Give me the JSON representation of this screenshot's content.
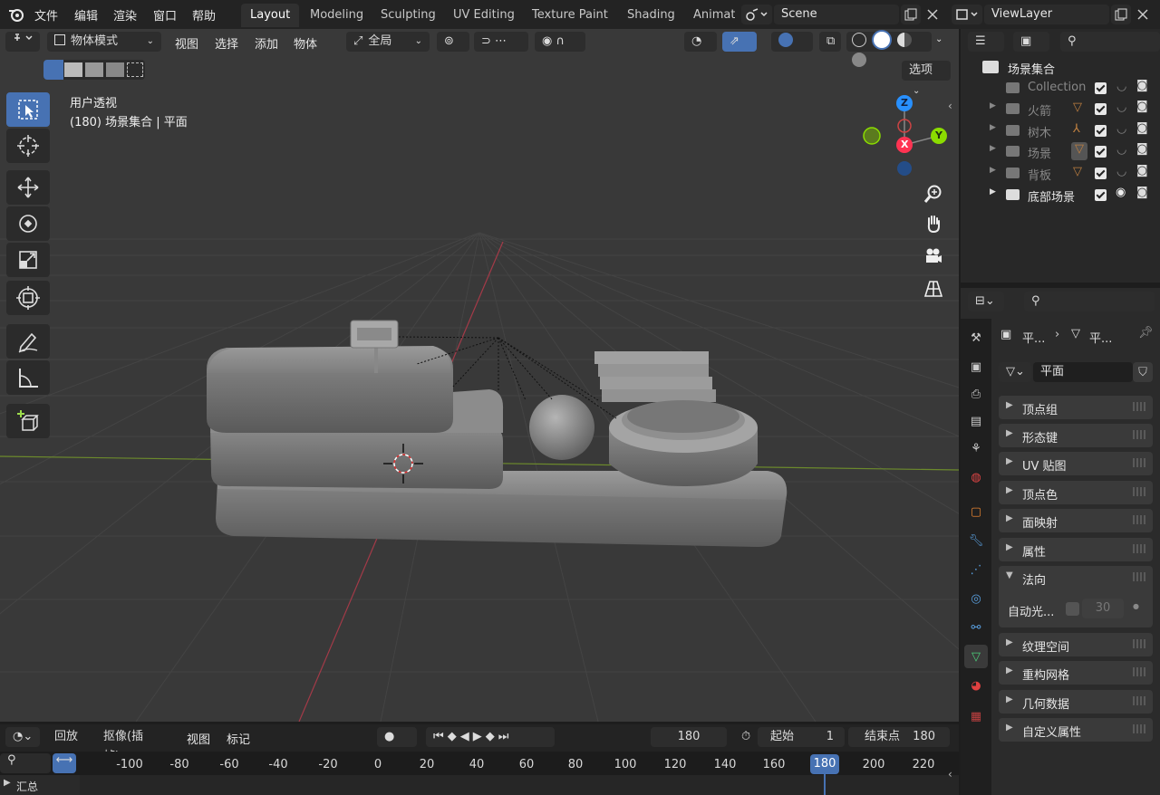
{
  "topbar": {
    "menus": [
      "文件",
      "编辑",
      "渲染",
      "窗口",
      "帮助"
    ],
    "workspaces": [
      "Layout",
      "Modeling",
      "Sculpting",
      "UV Editing",
      "Texture Paint",
      "Shading",
      "Animat"
    ],
    "active_workspace": "Layout",
    "scene_name": "Scene",
    "view_layer": "ViewLayer"
  },
  "viewport_header": {
    "mode": "物体模式",
    "menus": [
      "视图",
      "选择",
      "添加",
      "物体"
    ],
    "transform_orientation": "全局",
    "options_label": "选项"
  },
  "viewport_overlay": {
    "view_name": "用户透视",
    "object_info": "(180) 场景集合 | 平面"
  },
  "gizmo": {
    "x": "X",
    "y": "Y",
    "z": "Z"
  },
  "outliner": {
    "root": "场景集合",
    "items": [
      {
        "label": "Collection",
        "expandable": false
      },
      {
        "label": "火箭",
        "expandable": true
      },
      {
        "label": "树木",
        "expandable": true
      },
      {
        "label": "场景",
        "expandable": true
      },
      {
        "label": "背板",
        "expandable": true
      },
      {
        "label": "底部场景",
        "expandable": true
      }
    ]
  },
  "properties": {
    "breadcrumb_object": "平...",
    "breadcrumb_data": "平...",
    "mesh_name": "平面",
    "panels": [
      "顶点组",
      "形态键",
      "UV 贴图",
      "顶点色",
      "面映射",
      "属性",
      "法向",
      "纹理空间",
      "重构网格",
      "几何数据",
      "自定义属性"
    ],
    "normals": {
      "auto_smooth_label": "自动光...",
      "angle": "30"
    }
  },
  "timeline": {
    "playback": "回放",
    "keying": "抠像(插帧)",
    "view": "视图",
    "marker": "标记",
    "current_frame": "180",
    "start_label": "起始",
    "start_value": "1",
    "end_label": "结束点",
    "end_value": "180",
    "ruler": [
      "-100",
      "-80",
      "-60",
      "-40",
      "-20",
      "0",
      "20",
      "40",
      "60",
      "80",
      "100",
      "120",
      "140",
      "160",
      "180",
      "200",
      "220"
    ],
    "summary": "汇总"
  },
  "colors": {
    "accent": "#4772b3",
    "axis_x": "#ff3352",
    "axis_y": "#8bdc00",
    "axis_z": "#2890ff"
  }
}
